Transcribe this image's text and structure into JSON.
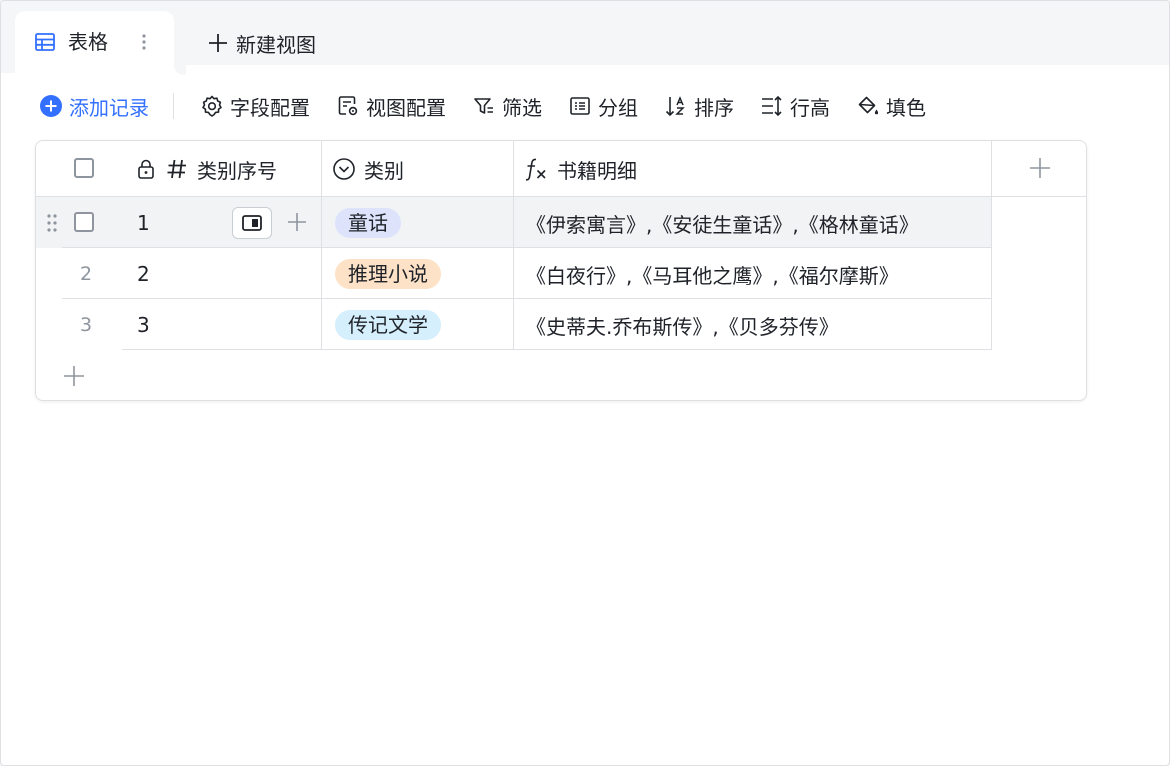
{
  "tabs": {
    "active": {
      "label": "表格",
      "icon": "table-icon"
    },
    "new_view": {
      "label": "新建视图",
      "icon": "plus-icon"
    }
  },
  "toolbar": {
    "add_record": "添加记录",
    "field_config": "字段配置",
    "view_config": "视图配置",
    "filter": "筛选",
    "group": "分组",
    "sort": "排序",
    "row_height": "行高",
    "fill_color": "填色"
  },
  "table": {
    "columns": [
      {
        "label": "类别序号",
        "icon": "hash-icon",
        "locked": true
      },
      {
        "label": "类别",
        "icon": "single-select-icon"
      },
      {
        "label": "书籍明细",
        "icon": "formula-icon"
      }
    ],
    "rows": [
      {
        "index": "1",
        "id": "1",
        "category": "童话",
        "category_color": "#dde3fb",
        "books": "《伊索寓言》,《安徒生童话》,《格林童话》"
      },
      {
        "index": "2",
        "id": "2",
        "category": "推理小说",
        "category_color": "#fde2c8",
        "books": "《白夜行》,《马耳他之鹰》,《福尔摩斯》"
      },
      {
        "index": "3",
        "id": "3",
        "category": "传记文学",
        "category_color": "#d5effc",
        "books": "《史蒂夫.乔布斯传》,《贝多芬传》"
      }
    ]
  },
  "colors": {
    "accent": "#3370ff",
    "border": "#dee0e3",
    "hover_row": "#f2f3f5"
  }
}
